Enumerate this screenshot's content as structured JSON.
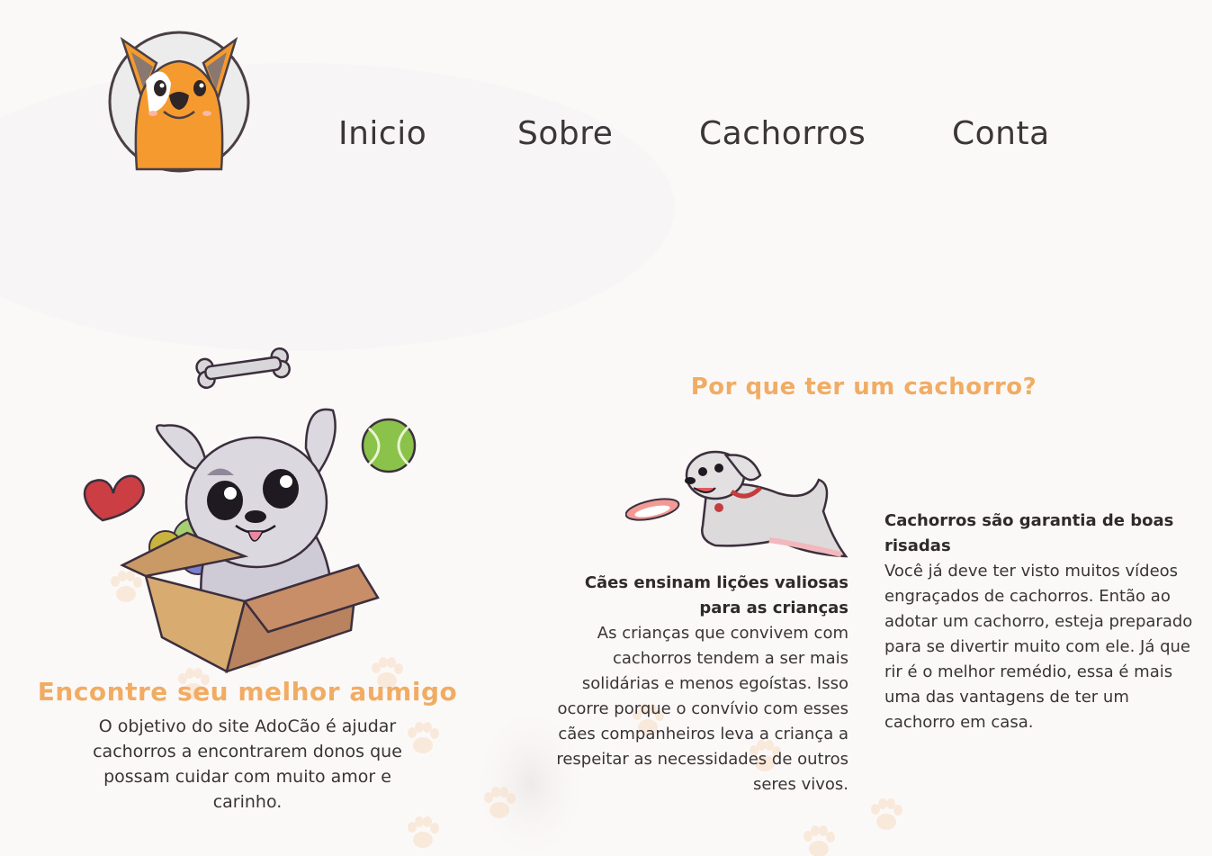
{
  "nav": {
    "items": [
      {
        "label": "Inicio"
      },
      {
        "label": "Sobre"
      },
      {
        "label": "Cachorros"
      },
      {
        "label": "Conta"
      }
    ]
  },
  "hero": {
    "title": "Encontre seu melhor aumigo",
    "text": "O objetivo do site AdoCão é ajudar cachorros a encontrarem donos que possam cuidar com muito amor e carinho."
  },
  "why": {
    "title": "Por que ter um cachorro?",
    "cards": [
      {
        "title": "Cães ensinam lições valiosas para as crianças",
        "body": "As crianças que convivem com cachorros tendem a ser mais solidárias e menos egoístas. Isso ocorre porque o convívio com esses cães companheiros leva a criança a respeitar as necessidades de outros seres vivos."
      },
      {
        "title": "Cachorros são garantia de boas risadas",
        "body": "Você já deve ter visto muitos vídeos engraçados de cachorros. Então ao adotar um cachorro, esteja preparado para se divertir muito com ele. Já que rir é o melhor remédio, essa é mais uma das vantagens de ter um cachorro em casa."
      }
    ]
  },
  "colors": {
    "accent": "#f1ac64",
    "text": "#3a3436",
    "background": "#fbf9f8"
  }
}
